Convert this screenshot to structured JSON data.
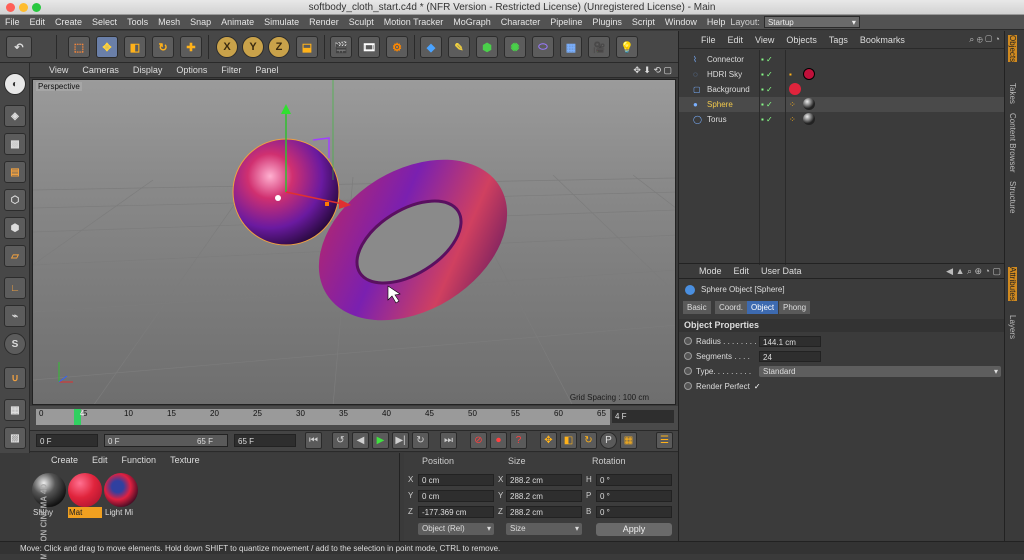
{
  "window": {
    "title": "softbody_cloth_start.c4d * (NFR Version - Restricted License) (Unregistered License) - Main"
  },
  "menubar": {
    "items": [
      "File",
      "Edit",
      "Create",
      "Select",
      "Tools",
      "Mesh",
      "Snap",
      "Animate",
      "Simulate",
      "Render",
      "Sculpt",
      "Motion Tracker",
      "MoGraph",
      "Character",
      "Pipeline",
      "Plugins",
      "Script",
      "Window",
      "Help"
    ],
    "layout_label": "Layout:",
    "layout_value": "Startup"
  },
  "toolbar": {
    "axis_buttons": [
      "X",
      "Y",
      "Z"
    ]
  },
  "viewport": {
    "menu": [
      "View",
      "Cameras",
      "Display",
      "Options",
      "Filter",
      "Panel"
    ],
    "label": "Perspective",
    "grid_spacing": "Grid Spacing : 100 cm"
  },
  "timeline": {
    "ticks": [
      "0",
      "5",
      "10",
      "15",
      "20",
      "25",
      "30",
      "35",
      "40",
      "45",
      "50",
      "55",
      "60",
      "65"
    ],
    "current_marker": "4",
    "current_frame": "4 F",
    "start_field": "0 F",
    "range_start": "0 F",
    "range_end": "65 F",
    "end_field": "65 F"
  },
  "materials": {
    "menu": [
      "Create",
      "Edit",
      "Function",
      "Texture"
    ],
    "items": [
      {
        "name": "Shiny",
        "color": "#222222"
      },
      {
        "name": "Mat",
        "color": "#e0243c"
      },
      {
        "name": "Light Mi",
        "color": "#9b1a2a"
      }
    ],
    "brand": "MAXON CINEMA 4D"
  },
  "coordinates": {
    "headers": [
      "Position",
      "Size",
      "Rotation"
    ],
    "position": [
      {
        "axis": "X",
        "value": "0 cm"
      },
      {
        "axis": "Y",
        "value": "0 cm"
      },
      {
        "axis": "Z",
        "value": "-177.369 cm"
      }
    ],
    "size": [
      {
        "axis": "X",
        "value": "288.2 cm"
      },
      {
        "axis": "Y",
        "value": "288.2 cm"
      },
      {
        "axis": "Z",
        "value": "288.2 cm"
      }
    ],
    "rotation": [
      {
        "axis": "H",
        "value": "0 °"
      },
      {
        "axis": "P",
        "value": "0 °"
      },
      {
        "axis": "B",
        "value": "0 °"
      }
    ],
    "mode": "Object (Rel)",
    "size_mode": "Size",
    "apply": "Apply"
  },
  "object_manager": {
    "menu": [
      "File",
      "Edit",
      "View",
      "Objects",
      "Tags",
      "Bookmarks"
    ],
    "objects": [
      {
        "name": "Connector",
        "color": "#dddddd"
      },
      {
        "name": "HDRI Sky",
        "color": "#dddddd"
      },
      {
        "name": "Background",
        "color": "#dddddd"
      },
      {
        "name": "Sphere",
        "color": "#f2c94c"
      },
      {
        "name": "Torus",
        "color": "#dddddd"
      }
    ]
  },
  "attributes": {
    "menu": [
      "Mode",
      "Edit",
      "User Data"
    ],
    "object_title": "Sphere Object [Sphere]",
    "tabs": [
      "Basic",
      "Coord.",
      "Object",
      "Phong"
    ],
    "active_tab": "Object",
    "section": "Object Properties",
    "radius_label": "Radius . . . . . . . .",
    "radius": "144.1 cm",
    "segments_label": "Segments . . . .",
    "segments": "24",
    "type_label": "Type. . . . . . . . .",
    "type": "Standard",
    "render_perfect": "Render Perfect"
  },
  "side_tabs": [
    "Objects",
    "Takes",
    "Content Browser",
    "Structure",
    "Attributes",
    "Layers"
  ],
  "status": {
    "text": "Move: Click and drag to move elements. Hold down SHIFT to quantize movement / add to the selection in point mode, CTRL to remove."
  }
}
